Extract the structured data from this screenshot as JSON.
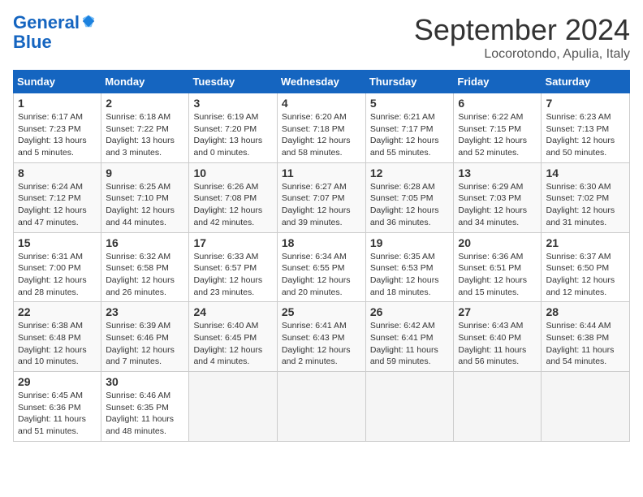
{
  "header": {
    "logo_line1": "General",
    "logo_line2": "Blue",
    "month_title": "September 2024",
    "location": "Locorotondo, Apulia, Italy"
  },
  "weekdays": [
    "Sunday",
    "Monday",
    "Tuesday",
    "Wednesday",
    "Thursday",
    "Friday",
    "Saturday"
  ],
  "weeks": [
    [
      {
        "day": "1",
        "sunrise": "Sunrise: 6:17 AM",
        "sunset": "Sunset: 7:23 PM",
        "daylight": "Daylight: 13 hours and 5 minutes."
      },
      {
        "day": "2",
        "sunrise": "Sunrise: 6:18 AM",
        "sunset": "Sunset: 7:22 PM",
        "daylight": "Daylight: 13 hours and 3 minutes."
      },
      {
        "day": "3",
        "sunrise": "Sunrise: 6:19 AM",
        "sunset": "Sunset: 7:20 PM",
        "daylight": "Daylight: 13 hours and 0 minutes."
      },
      {
        "day": "4",
        "sunrise": "Sunrise: 6:20 AM",
        "sunset": "Sunset: 7:18 PM",
        "daylight": "Daylight: 12 hours and 58 minutes."
      },
      {
        "day": "5",
        "sunrise": "Sunrise: 6:21 AM",
        "sunset": "Sunset: 7:17 PM",
        "daylight": "Daylight: 12 hours and 55 minutes."
      },
      {
        "day": "6",
        "sunrise": "Sunrise: 6:22 AM",
        "sunset": "Sunset: 7:15 PM",
        "daylight": "Daylight: 12 hours and 52 minutes."
      },
      {
        "day": "7",
        "sunrise": "Sunrise: 6:23 AM",
        "sunset": "Sunset: 7:13 PM",
        "daylight": "Daylight: 12 hours and 50 minutes."
      }
    ],
    [
      {
        "day": "8",
        "sunrise": "Sunrise: 6:24 AM",
        "sunset": "Sunset: 7:12 PM",
        "daylight": "Daylight: 12 hours and 47 minutes."
      },
      {
        "day": "9",
        "sunrise": "Sunrise: 6:25 AM",
        "sunset": "Sunset: 7:10 PM",
        "daylight": "Daylight: 12 hours and 44 minutes."
      },
      {
        "day": "10",
        "sunrise": "Sunrise: 6:26 AM",
        "sunset": "Sunset: 7:08 PM",
        "daylight": "Daylight: 12 hours and 42 minutes."
      },
      {
        "day": "11",
        "sunrise": "Sunrise: 6:27 AM",
        "sunset": "Sunset: 7:07 PM",
        "daylight": "Daylight: 12 hours and 39 minutes."
      },
      {
        "day": "12",
        "sunrise": "Sunrise: 6:28 AM",
        "sunset": "Sunset: 7:05 PM",
        "daylight": "Daylight: 12 hours and 36 minutes."
      },
      {
        "day": "13",
        "sunrise": "Sunrise: 6:29 AM",
        "sunset": "Sunset: 7:03 PM",
        "daylight": "Daylight: 12 hours and 34 minutes."
      },
      {
        "day": "14",
        "sunrise": "Sunrise: 6:30 AM",
        "sunset": "Sunset: 7:02 PM",
        "daylight": "Daylight: 12 hours and 31 minutes."
      }
    ],
    [
      {
        "day": "15",
        "sunrise": "Sunrise: 6:31 AM",
        "sunset": "Sunset: 7:00 PM",
        "daylight": "Daylight: 12 hours and 28 minutes."
      },
      {
        "day": "16",
        "sunrise": "Sunrise: 6:32 AM",
        "sunset": "Sunset: 6:58 PM",
        "daylight": "Daylight: 12 hours and 26 minutes."
      },
      {
        "day": "17",
        "sunrise": "Sunrise: 6:33 AM",
        "sunset": "Sunset: 6:57 PM",
        "daylight": "Daylight: 12 hours and 23 minutes."
      },
      {
        "day": "18",
        "sunrise": "Sunrise: 6:34 AM",
        "sunset": "Sunset: 6:55 PM",
        "daylight": "Daylight: 12 hours and 20 minutes."
      },
      {
        "day": "19",
        "sunrise": "Sunrise: 6:35 AM",
        "sunset": "Sunset: 6:53 PM",
        "daylight": "Daylight: 12 hours and 18 minutes."
      },
      {
        "day": "20",
        "sunrise": "Sunrise: 6:36 AM",
        "sunset": "Sunset: 6:51 PM",
        "daylight": "Daylight: 12 hours and 15 minutes."
      },
      {
        "day": "21",
        "sunrise": "Sunrise: 6:37 AM",
        "sunset": "Sunset: 6:50 PM",
        "daylight": "Daylight: 12 hours and 12 minutes."
      }
    ],
    [
      {
        "day": "22",
        "sunrise": "Sunrise: 6:38 AM",
        "sunset": "Sunset: 6:48 PM",
        "daylight": "Daylight: 12 hours and 10 minutes."
      },
      {
        "day": "23",
        "sunrise": "Sunrise: 6:39 AM",
        "sunset": "Sunset: 6:46 PM",
        "daylight": "Daylight: 12 hours and 7 minutes."
      },
      {
        "day": "24",
        "sunrise": "Sunrise: 6:40 AM",
        "sunset": "Sunset: 6:45 PM",
        "daylight": "Daylight: 12 hours and 4 minutes."
      },
      {
        "day": "25",
        "sunrise": "Sunrise: 6:41 AM",
        "sunset": "Sunset: 6:43 PM",
        "daylight": "Daylight: 12 hours and 2 minutes."
      },
      {
        "day": "26",
        "sunrise": "Sunrise: 6:42 AM",
        "sunset": "Sunset: 6:41 PM",
        "daylight": "Daylight: 11 hours and 59 minutes."
      },
      {
        "day": "27",
        "sunrise": "Sunrise: 6:43 AM",
        "sunset": "Sunset: 6:40 PM",
        "daylight": "Daylight: 11 hours and 56 minutes."
      },
      {
        "day": "28",
        "sunrise": "Sunrise: 6:44 AM",
        "sunset": "Sunset: 6:38 PM",
        "daylight": "Daylight: 11 hours and 54 minutes."
      }
    ],
    [
      {
        "day": "29",
        "sunrise": "Sunrise: 6:45 AM",
        "sunset": "Sunset: 6:36 PM",
        "daylight": "Daylight: 11 hours and 51 minutes."
      },
      {
        "day": "30",
        "sunrise": "Sunrise: 6:46 AM",
        "sunset": "Sunset: 6:35 PM",
        "daylight": "Daylight: 11 hours and 48 minutes."
      },
      null,
      null,
      null,
      null,
      null
    ]
  ]
}
